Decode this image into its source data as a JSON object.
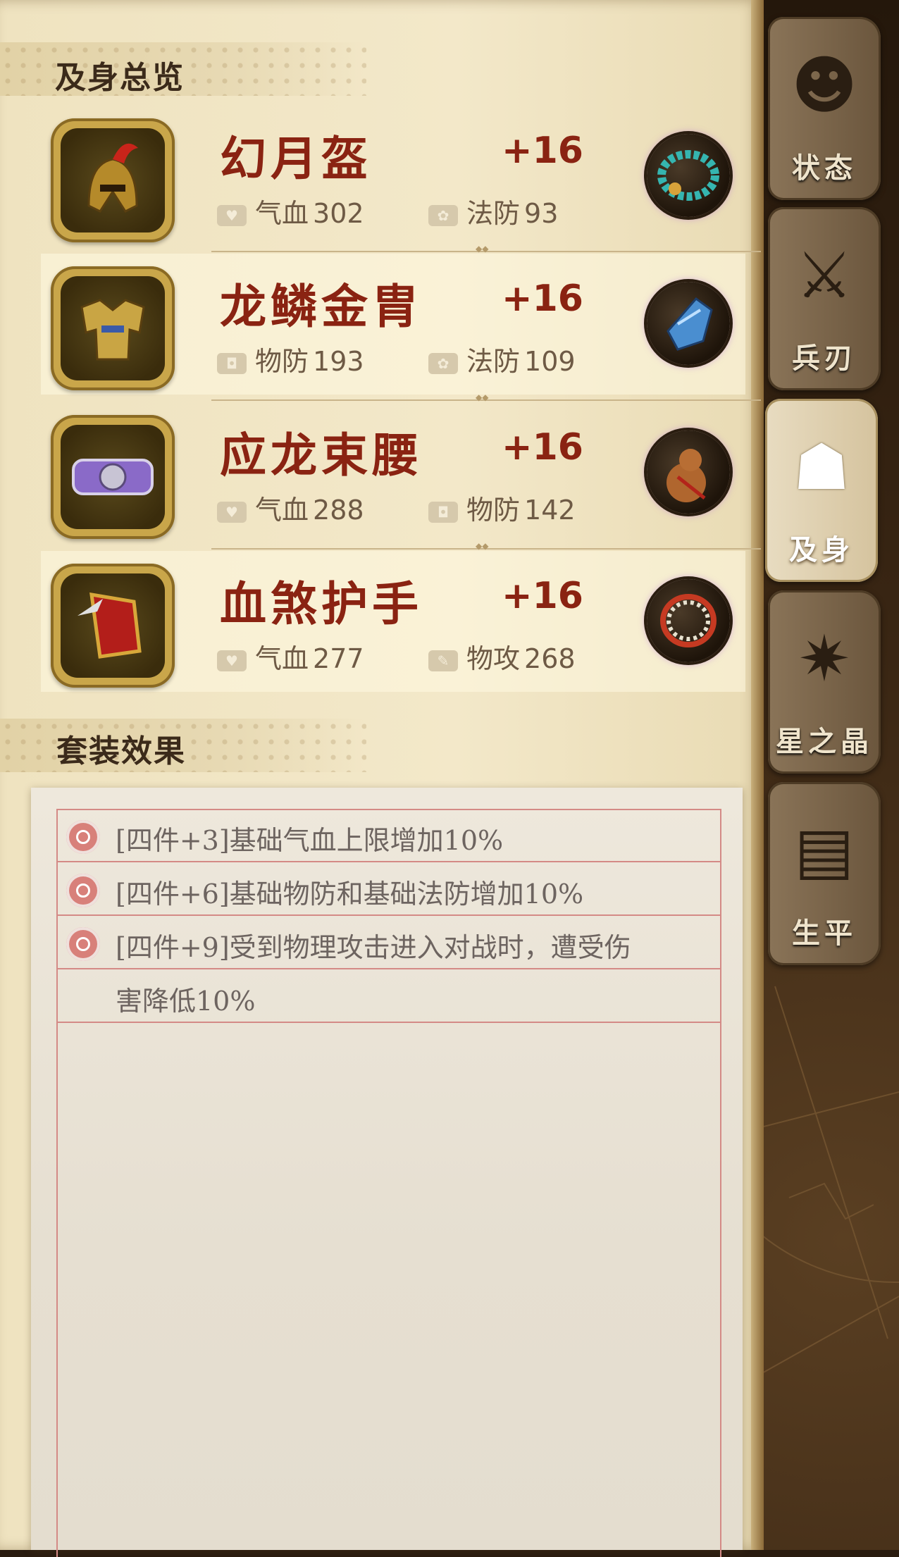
{
  "overview": {
    "title": "及身总览",
    "items": [
      {
        "name": "幻月盔",
        "level": "+16",
        "stat1": {
          "icon": "heart-icon",
          "label": "气血",
          "value": "302"
        },
        "stat2": {
          "icon": "magic-defense-icon",
          "label": "法防",
          "value": "93"
        },
        "gem": "turquoise-bead-bracelet-icon",
        "item_icon": "helmet-icon",
        "highlighted": false
      },
      {
        "name": "龙鳞金胄",
        "level": "+16",
        "stat1": {
          "icon": "shield-icon",
          "label": "物防",
          "value": "193"
        },
        "stat2": {
          "icon": "magic-defense-icon",
          "label": "法防",
          "value": "109"
        },
        "gem": "blue-crystal-icon",
        "item_icon": "armor-icon",
        "highlighted": true
      },
      {
        "name": "应龙束腰",
        "level": "+16",
        "stat1": {
          "icon": "heart-icon",
          "label": "气血",
          "value": "288"
        },
        "stat2": {
          "icon": "shield-icon",
          "label": "物防",
          "value": "142"
        },
        "gem": "gourd-icon",
        "item_icon": "belt-icon",
        "highlighted": false
      },
      {
        "name": "血煞护手",
        "level": "+16",
        "stat1": {
          "icon": "heart-icon",
          "label": "气血",
          "value": "277"
        },
        "stat2": {
          "icon": "attack-icon",
          "label": "物攻",
          "value": "268"
        },
        "gem": "pearl-bracelet-icon",
        "item_icon": "gauntlet-icon",
        "highlighted": true
      }
    ]
  },
  "set_effects": {
    "title": "套装效果",
    "effects": [
      "[四件+3]基础气血上限增加10%",
      "[四件+6]基础物防和基础法防增加10%",
      "[四件+9]受到物理攻击进入对战时，遭受伤",
      "害降低10%"
    ]
  },
  "tabs": [
    {
      "label": "状态",
      "icon": "character-head-icon",
      "active": false
    },
    {
      "label": "兵刃",
      "icon": "sword-icon",
      "active": false
    },
    {
      "label": "及身",
      "icon": "robe-icon",
      "active": true
    },
    {
      "label": "星之晶",
      "icon": "star-crystal-icon",
      "active": false
    },
    {
      "label": "生平",
      "icon": "book-icon",
      "active": false
    }
  ],
  "colors": {
    "item_name": "#8a2312",
    "parchment": "#f3e8c9",
    "effect_line": "#d48a86"
  }
}
